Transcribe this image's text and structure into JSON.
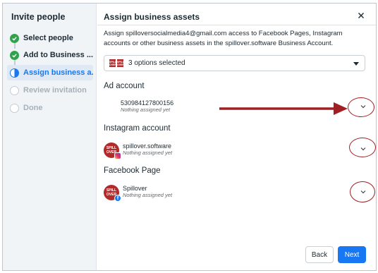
{
  "sidebar": {
    "title": "Invite people",
    "steps": [
      {
        "label": "Select people",
        "state": "done"
      },
      {
        "label": "Add to Business ...",
        "state": "done"
      },
      {
        "label": "Assign business a...",
        "state": "current"
      },
      {
        "label": "Review invitation",
        "state": "todo"
      },
      {
        "label": "Done",
        "state": "todo"
      }
    ]
  },
  "main": {
    "title": "Assign business assets",
    "description": "Assign spilloversocialmedia4@gmail.com access to Facebook Pages, Instagram accounts or other business assets in the spillover.software Business Account.",
    "selector_text": "3 options selected",
    "thumb_text": "SPILL OVER",
    "sections": [
      {
        "title": "Ad account",
        "asset_name": "530984127800156",
        "asset_status": "Nothing assigned yet"
      },
      {
        "title": "Instagram account",
        "asset_name": "spillover.software",
        "asset_status": "Nothing assigned yet"
      },
      {
        "title": "Facebook Page",
        "asset_name": "Spillover",
        "asset_status": "Nothing assigned yet"
      }
    ],
    "avatar_text": "SPILL OVER"
  },
  "footer": {
    "back_label": "Back",
    "next_label": "Next"
  },
  "colors": {
    "accent": "#1877f2",
    "success": "#31a24c",
    "brand_red": "#b22a2a",
    "annotation": "#a11f23"
  }
}
